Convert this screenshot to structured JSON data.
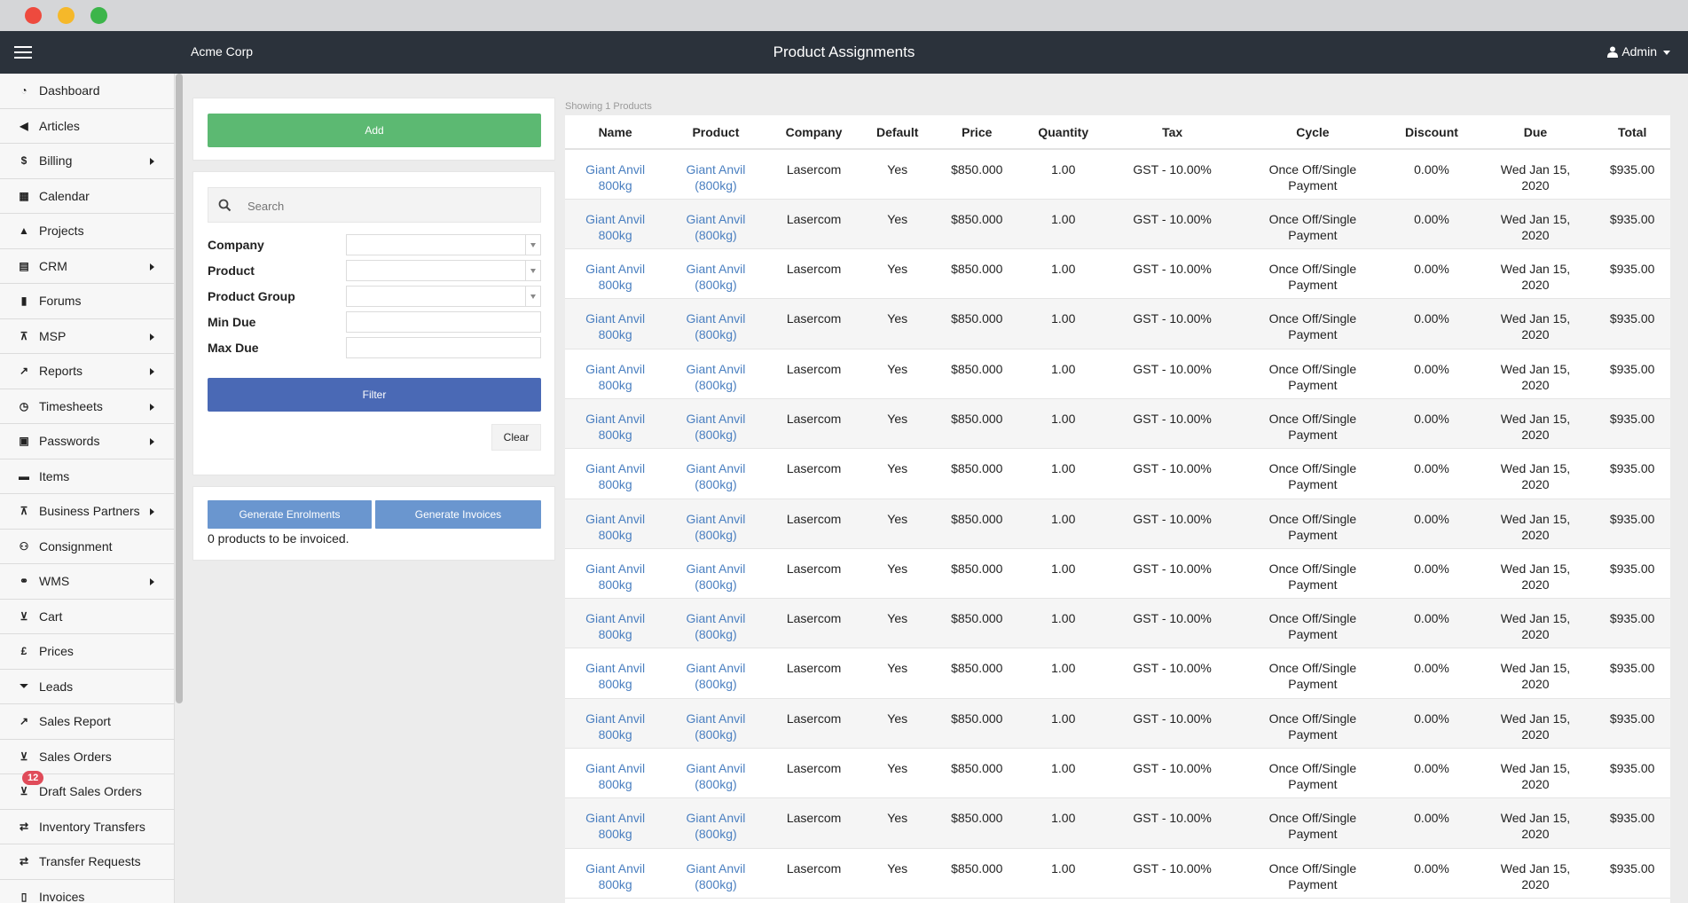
{
  "window": {
    "title": "Product Assignments"
  },
  "topbar": {
    "brand": "Acme Corp",
    "title": "Product Assignments",
    "user": "Admin"
  },
  "sidebar": {
    "items": [
      {
        "label": "Dashboard",
        "icon": "dashboard-icon",
        "submenu": false
      },
      {
        "label": "Articles",
        "icon": "megaphone-icon",
        "submenu": false
      },
      {
        "label": "Billing",
        "icon": "dollar-icon",
        "submenu": true
      },
      {
        "label": "Calendar",
        "icon": "calendar-icon",
        "submenu": false
      },
      {
        "label": "Projects",
        "icon": "projects-icon",
        "submenu": false
      },
      {
        "label": "CRM",
        "icon": "crm-icon",
        "submenu": true
      },
      {
        "label": "Forums",
        "icon": "book-icon",
        "submenu": false
      },
      {
        "label": "MSP",
        "icon": "sitemap-icon",
        "submenu": true
      },
      {
        "label": "Reports",
        "icon": "chart-icon",
        "submenu": true
      },
      {
        "label": "Timesheets",
        "icon": "clock-icon",
        "submenu": true
      },
      {
        "label": "Passwords",
        "icon": "lock-icon",
        "submenu": true
      },
      {
        "label": "Items",
        "icon": "briefcase-icon",
        "submenu": false
      },
      {
        "label": "Business Partners",
        "icon": "sitemap-icon",
        "submenu": true
      },
      {
        "label": "Consignment",
        "icon": "people-icon",
        "submenu": false
      },
      {
        "label": "WMS",
        "icon": "handshake-icon",
        "submenu": true
      },
      {
        "label": "Cart",
        "icon": "cart-icon",
        "submenu": false
      },
      {
        "label": "Prices",
        "icon": "pound-icon",
        "submenu": false
      },
      {
        "label": "Leads",
        "icon": "funnel-icon",
        "submenu": false
      },
      {
        "label": "Sales Report",
        "icon": "chart-icon",
        "submenu": false
      },
      {
        "label": "Sales Orders",
        "icon": "cart-icon",
        "submenu": false
      },
      {
        "label": "Draft Sales Orders",
        "icon": "cart-icon",
        "submenu": false,
        "badge": "12"
      },
      {
        "label": "Inventory Transfers",
        "icon": "exchange-icon",
        "submenu": false
      },
      {
        "label": "Transfer Requests",
        "icon": "exchange-icon",
        "submenu": false
      },
      {
        "label": "Invoices",
        "icon": "file-icon",
        "submenu": false
      }
    ]
  },
  "actions": {
    "add_label": "Add"
  },
  "filters": {
    "search_placeholder": "Search",
    "company_label": "Company",
    "product_label": "Product",
    "product_group_label": "Product Group",
    "min_due_label": "Min Due",
    "max_due_label": "Max Due",
    "filter_label": "Filter",
    "clear_label": "Clear"
  },
  "generate": {
    "enrolments_label": "Generate Enrolments",
    "invoices_label": "Generate Invoices",
    "status_text": "0 products to be invoiced."
  },
  "table": {
    "showing_text": "Showing 1 Products",
    "columns": [
      "Name",
      "Product",
      "Company",
      "Default",
      "Price",
      "Quantity",
      "Tax",
      "Cycle",
      "Discount",
      "Due",
      "Total"
    ],
    "row_template": {
      "name_line1": "Giant Anvil",
      "name_line2": "800kg",
      "product_line1": "Giant Anvil",
      "product_line2": "(800kg)",
      "company": "Lasercom",
      "default": "Yes",
      "price": "$850.000",
      "quantity": "1.00",
      "tax": "GST - 10.00%",
      "cycle_line1": "Once Off/Single",
      "cycle_line2": "Payment",
      "discount": "0.00%",
      "due_line1": "Wed Jan 15,",
      "due_line2": "2020",
      "total": "$935.00"
    },
    "row_count": 15
  }
}
